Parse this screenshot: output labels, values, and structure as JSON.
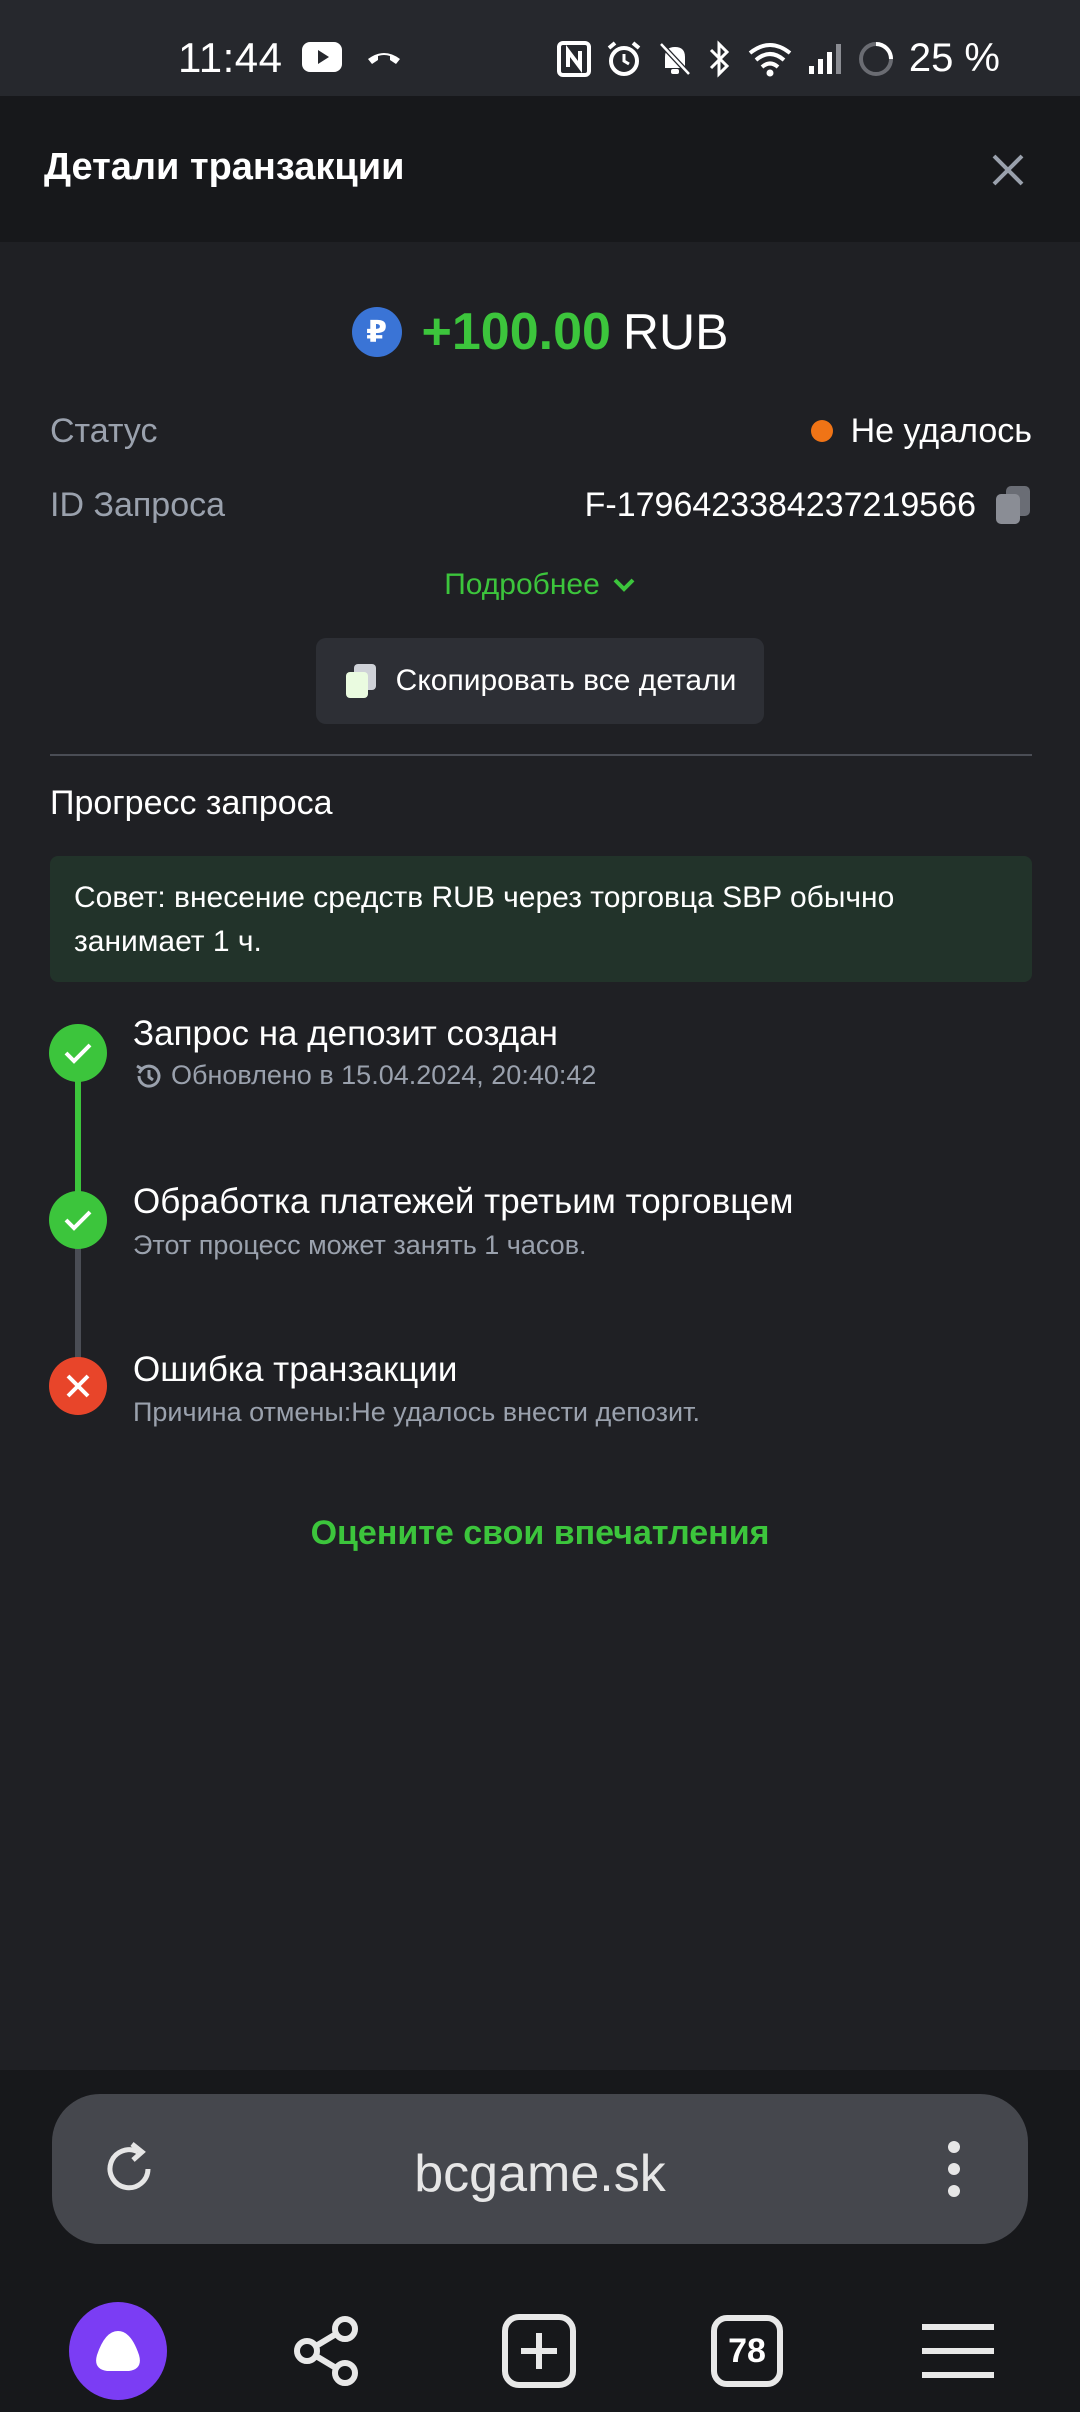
{
  "status_bar": {
    "time": "11:44",
    "battery": "25 %",
    "icons": [
      "youtube-icon",
      "phone-icon",
      "nfc-icon",
      "alarm-icon",
      "bell-off-icon",
      "bluetooth-icon",
      "wifi-icon",
      "signal-icon",
      "battery-ring-icon"
    ]
  },
  "header": {
    "title": "Детали транзакции"
  },
  "amount": {
    "currency_symbol": "₽",
    "value": "+100.00",
    "currency": "RUB"
  },
  "details": {
    "status_label": "Статус",
    "status_value": "Не удалось",
    "request_id_label": "ID Запроса",
    "request_id_value": "F-1796423384237219566"
  },
  "more_link": "Подробнее",
  "copy_all_label": "Скопировать все детали",
  "progress": {
    "title": "Прогресс запроса",
    "tip": "Совет: внесение средств RUB через торговца SBP обычно занимает 1 ч.",
    "steps": [
      {
        "title": "Запрос на депозит создан",
        "subtitle": "Обновлено в 15.04.2024, 20:40:42",
        "state": "done"
      },
      {
        "title": "Обработка платежей третьим торговцем",
        "subtitle": "Этот процесс может занять 1 часов.",
        "state": "done"
      },
      {
        "title": "Ошибка транзакции",
        "subtitle": "Причина отмены:Не удалось внести депозит.",
        "state": "error"
      }
    ]
  },
  "rate_link": "Оцените свои впечатления",
  "browser": {
    "url": "bcgame.sk",
    "tabs_count": "78"
  },
  "colors": {
    "accent_green": "#3cc53c",
    "error_red": "#e8452a",
    "status_orange": "#f07416",
    "alice_purple": "#7b3df4"
  }
}
